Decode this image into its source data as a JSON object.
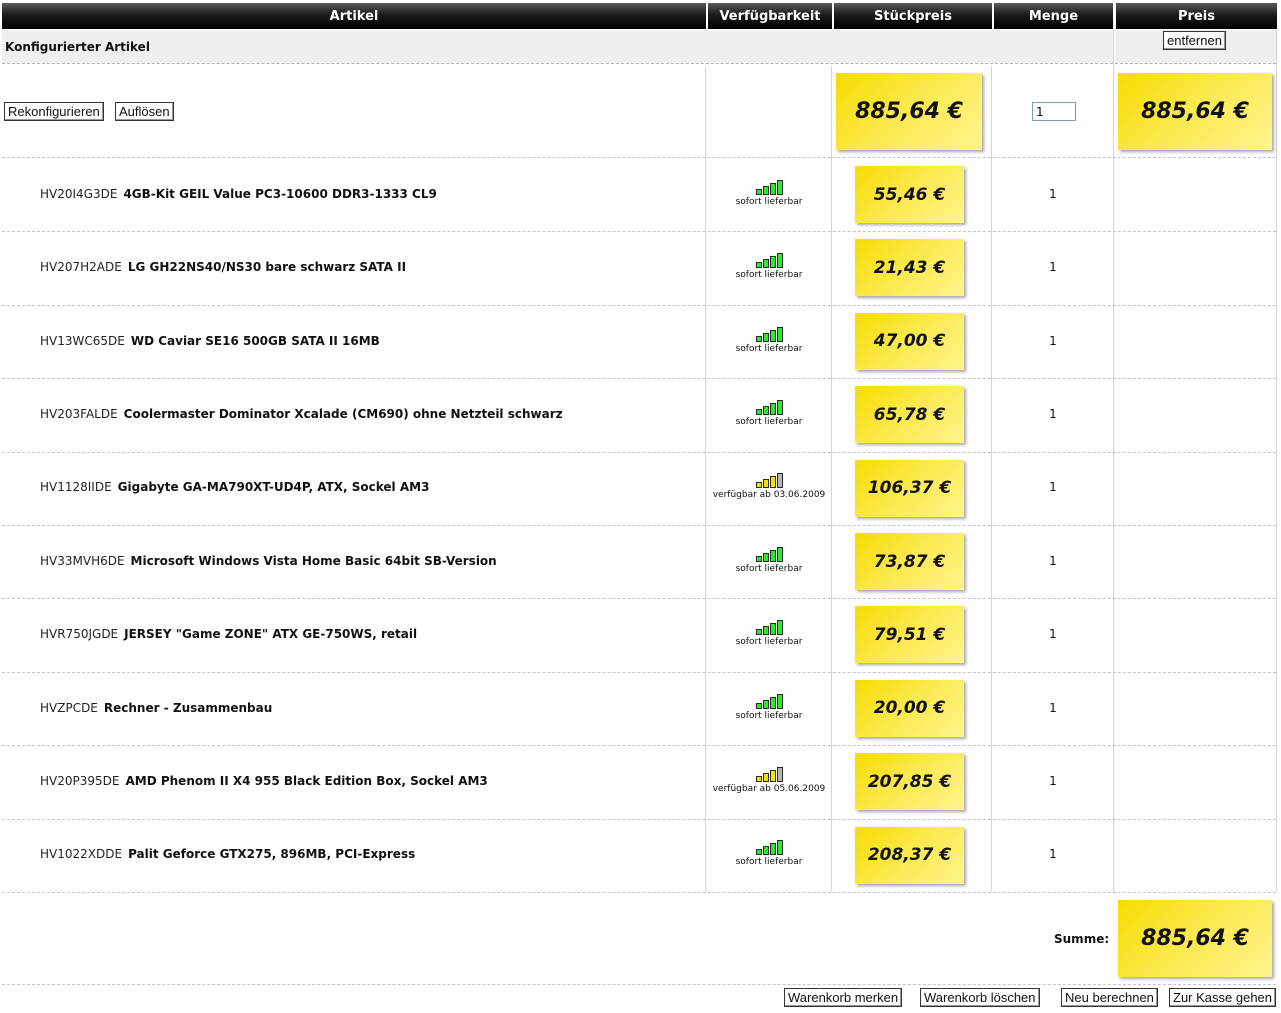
{
  "header": {
    "artikel": "Artikel",
    "verfuegbarkeit": "Verfügbarkeit",
    "stueckpreis": "Stückpreis",
    "menge": "Menge",
    "preis": "Preis"
  },
  "configured": {
    "title": "Konfigurierter Artikel",
    "remove_label": "entfernen",
    "reconfigure_label": "Rekonfigurieren",
    "dissolve_label": "Auflösen",
    "unit_price": "885,64 €",
    "quantity": "1",
    "total_price": "885,64 €"
  },
  "items": [
    {
      "sku": "HV20I4G3DE",
      "name": "4GB-Kit GEIL Value PC3-10600 DDR3-1333 CL9",
      "availability": "sofort lieferbar",
      "status": "green",
      "price": "55,46 €",
      "qty": "1"
    },
    {
      "sku": "HV207H2ADE",
      "name": "LG GH22NS40/NS30 bare schwarz SATA II",
      "availability": "sofort lieferbar",
      "status": "green",
      "price": "21,43 €",
      "qty": "1"
    },
    {
      "sku": "HV13WC65DE",
      "name": "WD Caviar SE16 500GB SATA II 16MB",
      "availability": "sofort lieferbar",
      "status": "green",
      "price": "47,00 €",
      "qty": "1"
    },
    {
      "sku": "HV203FALDE",
      "name": "Coolermaster Dominator Xcalade (CM690) ohne Netzteil schwarz",
      "availability": "sofort lieferbar",
      "status": "green",
      "price": "65,78 €",
      "qty": "1"
    },
    {
      "sku": "HV1128IIDE",
      "name": "Gigabyte GA-MA790XT-UD4P, ATX, Sockel AM3",
      "availability": "verfügbar ab 03.06.2009",
      "status": "yellow",
      "price": "106,37 €",
      "qty": "1"
    },
    {
      "sku": "HV33MVH6DE",
      "name": "Microsoft Windows Vista Home Basic 64bit SB-Version",
      "availability": "sofort lieferbar",
      "status": "green",
      "price": "73,87 €",
      "qty": "1"
    },
    {
      "sku": "HVR750JGDE",
      "name": "JERSEY \"Game ZONE\" ATX GE-750WS, retail",
      "availability": "sofort lieferbar",
      "status": "green",
      "price": "79,51 €",
      "qty": "1"
    },
    {
      "sku": "HVZPCDE",
      "name": "Rechner - Zusammenbau",
      "availability": "sofort lieferbar",
      "status": "green",
      "price": "20,00 €",
      "qty": "1"
    },
    {
      "sku": "HV20P395DE",
      "name": "AMD Phenom II X4 955 Black Edition Box, Sockel AM3",
      "availability": "verfügbar ab 05.06.2009",
      "status": "yellow",
      "price": "207,85 €",
      "qty": "1"
    },
    {
      "sku": "HV1022XDDE",
      "name": "Palit Geforce GTX275, 896MB, PCI-Express",
      "availability": "sofort lieferbar",
      "status": "green",
      "price": "208,37 €",
      "qty": "1"
    }
  ],
  "summary": {
    "label": "Summe:",
    "total": "885,64 €"
  },
  "footer": {
    "remember": "Warenkorb merken",
    "clear": "Warenkorb löschen",
    "recalc": "Neu berechnen",
    "checkout": "Zur Kasse gehen"
  },
  "colors": {
    "green_bar": "#2ee82e",
    "yellow_bar": "#f2e200",
    "grey_bar": "#b5b5b5",
    "sticky": "#f6dc00"
  }
}
